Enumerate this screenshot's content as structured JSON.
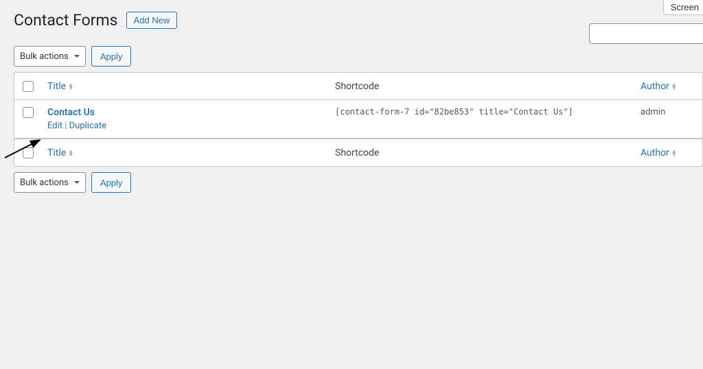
{
  "header": {
    "title": "Contact Forms",
    "add_new": "Add New"
  },
  "top": {
    "screen_options": "Screen",
    "search_placeholder": ""
  },
  "bulk": {
    "label": "Bulk actions",
    "apply": "Apply"
  },
  "columns": {
    "title": "Title",
    "shortcode": "Shortcode",
    "author": "Author"
  },
  "rows": [
    {
      "title": "Contact Us",
      "shortcode": "[contact-form-7 id=\"82be853\" title=\"Contact Us\"]",
      "author": "admin",
      "actions": {
        "edit": "Edit",
        "duplicate": "Duplicate"
      }
    }
  ]
}
